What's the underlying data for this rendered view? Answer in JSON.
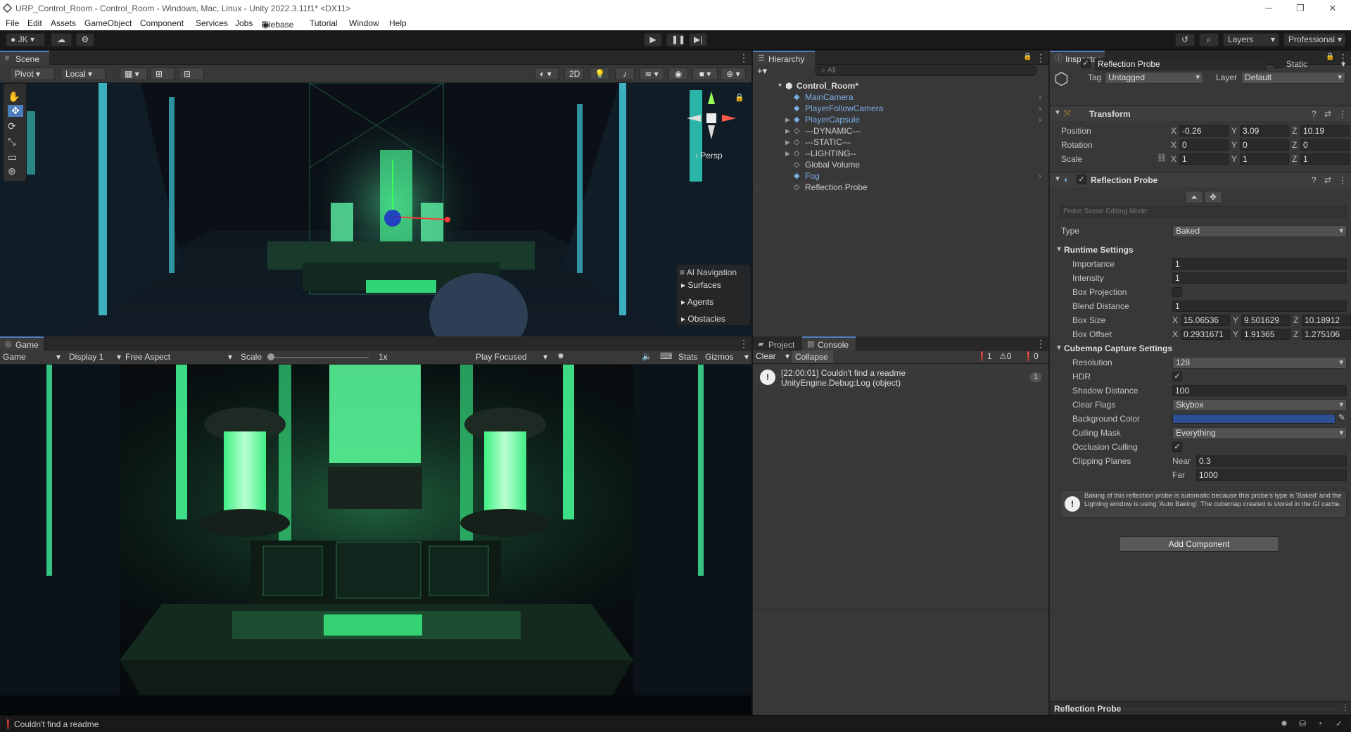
{
  "window": {
    "title": "URP_Control_Room - Control_Room - Windows, Mac, Linux - Unity 2022.3.11f1* <DX11>"
  },
  "menu": [
    "File",
    "Edit",
    "Assets",
    "GameObject",
    "Component",
    "Services",
    "Jobs",
    "Filebase",
    "Tutorial",
    "Window",
    "Help"
  ],
  "toolbar": {
    "account": "JK",
    "layers": "Layers",
    "layout": "Professional"
  },
  "scene": {
    "tab": "Scene",
    "pivot": "Pivot",
    "local": "Local",
    "mode2d": "2D",
    "persp": "Persp",
    "ai_nav_title": "AI Navigation",
    "ai_nav_items": [
      "Surfaces",
      "Agents",
      "Obstacles"
    ]
  },
  "game": {
    "tab": "Game",
    "mode": "Game",
    "display": "Display 1",
    "aspect": "Free Aspect",
    "scale_label": "Scale",
    "scale_value": "1x",
    "play_focus": "Play Focused",
    "stats": "Stats",
    "gizmos": "Gizmos"
  },
  "hierarchy": {
    "tab": "Hierarchy",
    "search_placeholder": "All",
    "root": "Control_Room*",
    "items": [
      {
        "label": "MainCamera",
        "blue": true
      },
      {
        "label": "PlayerFollowCamera",
        "blue": true
      },
      {
        "label": "PlayerCapsule",
        "blue": true
      },
      {
        "label": "---DYNAMIC---",
        "blue": false
      },
      {
        "label": "---STATIC---",
        "blue": false
      },
      {
        "label": "--LIGHTING--",
        "blue": false
      },
      {
        "label": "Global Volume",
        "blue": false
      },
      {
        "label": "Fog",
        "blue": true
      },
      {
        "label": "Reflection Probe",
        "blue": false
      }
    ]
  },
  "console": {
    "tab_project": "Project",
    "tab_console": "Console",
    "clear": "Clear",
    "collapse": "Collapse",
    "count_log": "1",
    "count_warn": "0",
    "count_err": "0",
    "entry_line1": "[22:00:01] Couldn't find a readme",
    "entry_line2": "UnityEngine.Debug:Log (object)",
    "entry_count": "1"
  },
  "inspector": {
    "tab": "Inspector",
    "object_name": "Reflection Probe",
    "static": "Static",
    "tag_label": "Tag",
    "tag": "Untagged",
    "layer_label": "Layer",
    "layer": "Default",
    "transform": {
      "title": "Transform",
      "position_label": "Position",
      "rotation_label": "Rotation",
      "scale_label": "Scale",
      "position": [
        "-0.26",
        "3.09",
        "10.19"
      ],
      "rotation": [
        "0",
        "0",
        "0"
      ],
      "scale": [
        "1",
        "1",
        "1"
      ]
    },
    "probe": {
      "title": "Reflection Probe",
      "editing_mode": "Probe Scene Editing Mode:",
      "type_label": "Type",
      "type": "Baked",
      "runtime_title": "Runtime Settings",
      "importance_label": "Importance",
      "importance": "1",
      "intensity_label": "Intensity",
      "intensity": "1",
      "box_projection_label": "Box Projection",
      "blend_label": "Blend Distance",
      "blend": "1",
      "box_size_label": "Box Size",
      "box_size": [
        "15.06536",
        "9.501629",
        "10.18912"
      ],
      "box_offset_label": "Box Offset",
      "box_offset": [
        "0.2931671",
        "1.91365",
        "1.275106"
      ],
      "cubemap_title": "Cubemap Capture Settings",
      "resolution_label": "Resolution",
      "resolution": "128",
      "hdr_label": "HDR",
      "shadow_label": "Shadow Distance",
      "shadow": "100",
      "clear_flags_label": "Clear Flags",
      "clear_flags": "Skybox",
      "bg_label": "Background Color",
      "bg_color": "#2d4f94",
      "culling_label": "Culling Mask",
      "culling": "Everything",
      "occlusion_label": "Occlusion Culling",
      "clipping_label": "Clipping Planes",
      "near_label": "Near",
      "near": "0.3",
      "far_label": "Far",
      "far": "1000",
      "help_text": "Baking of this reflection probe is automatic because this probe's type is 'Baked' and the Lighting window is using 'Auto Baking'. The cubemap created is stored in the GI cache."
    },
    "add_component": "Add Component",
    "footer": "Reflection Probe"
  },
  "status_bar": {
    "message": "Couldn't find a readme"
  },
  "colors": {
    "accent": "#4c7dbd",
    "neon": "#3dff8a",
    "panel": "#383838",
    "prefab_blue": "#7caee6"
  }
}
